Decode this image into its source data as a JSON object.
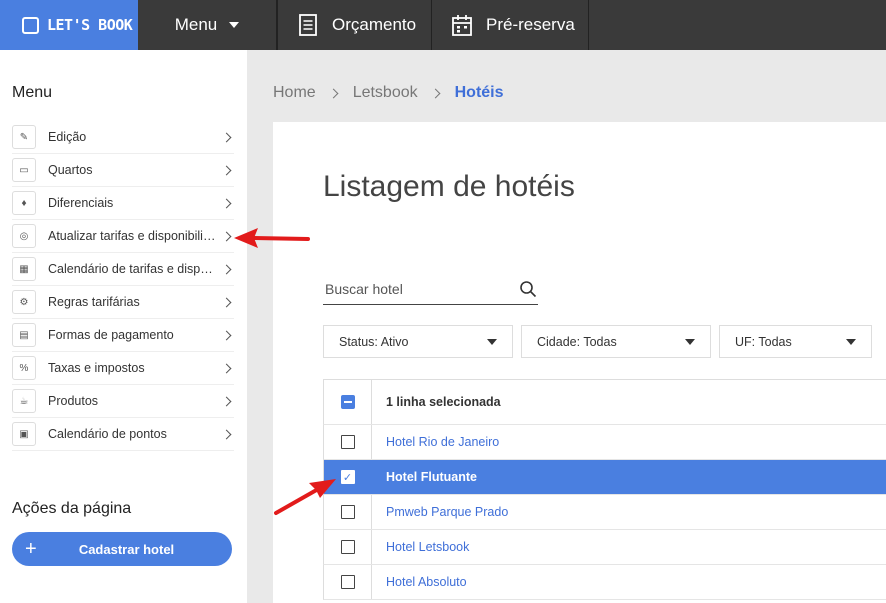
{
  "app": {
    "logo_text": "LET'S BOOK"
  },
  "topnav": {
    "menu_label": "Menu",
    "orcamento_label": "Orçamento",
    "prereserva_label": "Pré-reserva"
  },
  "sidebar": {
    "title": "Menu",
    "items": [
      {
        "label": "Edição",
        "icon": "pencil-icon",
        "glyph": "✎"
      },
      {
        "label": "Quartos",
        "icon": "bed-icon",
        "glyph": "▭"
      },
      {
        "label": "Diferenciais",
        "icon": "money-bag-icon",
        "glyph": "♦"
      },
      {
        "label": "Atualizar tarifas e disponibilidade",
        "icon": "target-icon",
        "glyph": "◎"
      },
      {
        "label": "Calendário de tarifas e disponibilidade",
        "icon": "grid-icon",
        "glyph": "▦"
      },
      {
        "label": "Regras tarifárias",
        "icon": "gears-icon",
        "glyph": "⚙"
      },
      {
        "label": "Formas de pagamento",
        "icon": "cards-icon",
        "glyph": "▤"
      },
      {
        "label": "Taxas e impostos",
        "icon": "percent-icon",
        "glyph": "%"
      },
      {
        "label": "Produtos",
        "icon": "products-icon",
        "glyph": "☕"
      },
      {
        "label": "Calendário de pontos",
        "icon": "calendar-icon",
        "glyph": "▣"
      }
    ],
    "actions_title": "Ações da página",
    "add_hotel_label": "Cadastrar hotel",
    "add_hotel_icon": "+"
  },
  "breadcrumb": {
    "items": [
      "Home",
      "Letsbook"
    ],
    "active": "Hotéis"
  },
  "main": {
    "title": "Listagem de hotéis",
    "search_placeholder": "Buscar hotel",
    "filters": {
      "status": "Status: Ativo",
      "cidade": "Cidade: Todas",
      "uf": "UF: Todas"
    },
    "table": {
      "header": "1 linha selecionada",
      "rows": [
        {
          "name": "Hotel Rio de Janeiro",
          "selected": false
        },
        {
          "name": "Hotel Flutuante",
          "selected": true
        },
        {
          "name": "Pmweb Parque Prado",
          "selected": false
        },
        {
          "name": "Hotel Letsbook",
          "selected": false
        },
        {
          "name": "Hotel Absoluto",
          "selected": false
        }
      ]
    }
  },
  "colors": {
    "accent": "#4a7fe0",
    "topbar": "#3a3a3a",
    "link": "#3f6fd8",
    "annotation_arrow": "#e21b1b"
  }
}
